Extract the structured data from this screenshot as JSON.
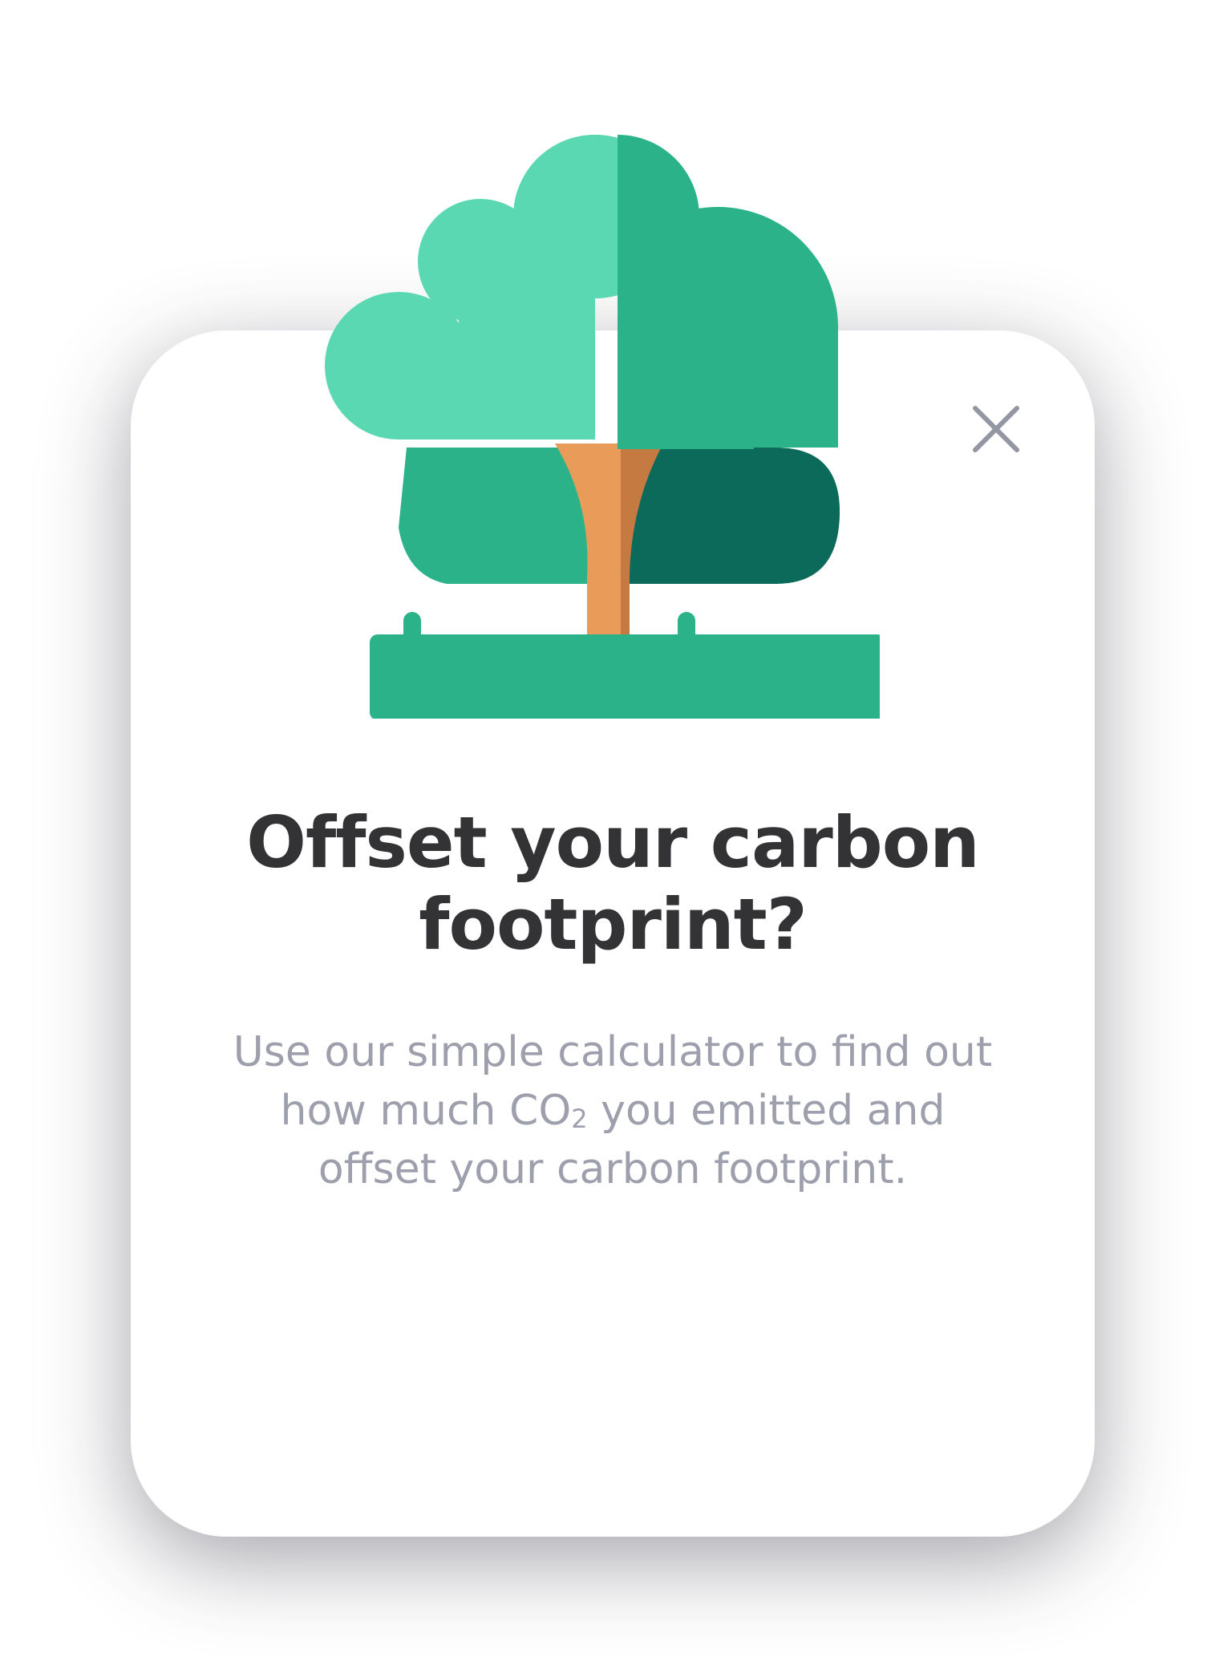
{
  "modal": {
    "title": "Offset your carbon footprint?",
    "description": {
      "line1": "Use our simple calculator to find out",
      "line2_before": "how much CO",
      "line2_subscript": "2",
      "line2_after": " you emitted and",
      "line3": "offset your carbon footprint."
    },
    "close_icon": "close-icon",
    "illustration": "tree-illustration"
  },
  "colors": {
    "foliage_light": "#5ad8b2",
    "foliage_mid": "#2bb289",
    "foliage_dark": "#0b6a5a",
    "trunk_light": "#e99c5a",
    "trunk_dark": "#c57a42",
    "ground": "#2bb289",
    "title": "#333335",
    "description": "#9d9fad",
    "close_icon": "#9497a3"
  }
}
